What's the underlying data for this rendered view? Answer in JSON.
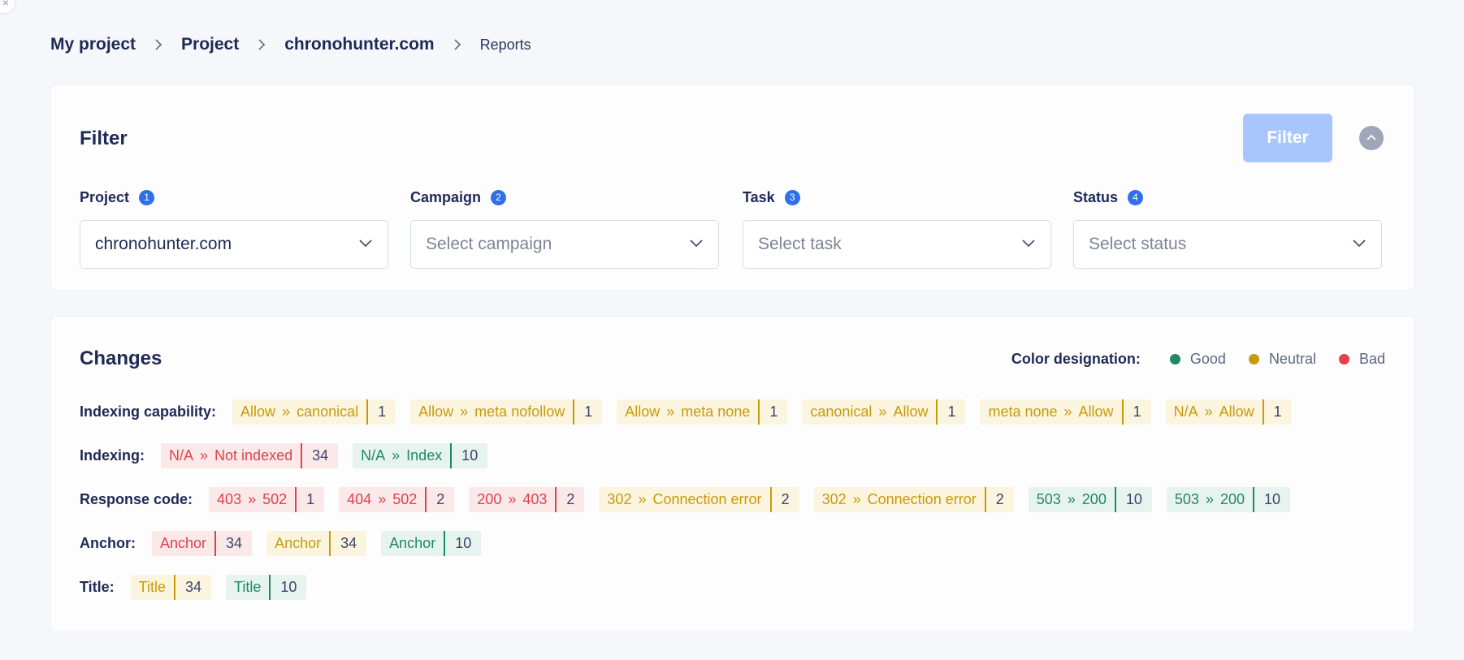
{
  "breadcrumb": {
    "items": [
      "My project",
      "Project",
      "chronohunter.com"
    ],
    "current": "Reports"
  },
  "filter": {
    "title": "Filter",
    "button_label": "Filter",
    "fields": [
      {
        "label": "Project",
        "badge": "1",
        "value": "chronohunter.com",
        "placeholder": false
      },
      {
        "label": "Campaign",
        "badge": "2",
        "value": "Select campaign",
        "placeholder": true
      },
      {
        "label": "Task",
        "badge": "3",
        "value": "Select task",
        "placeholder": true
      },
      {
        "label": "Status",
        "badge": "4",
        "value": "Select status",
        "placeholder": true
      }
    ]
  },
  "changes": {
    "title": "Changes",
    "legend": {
      "title": "Color designation:",
      "items": [
        {
          "label": "Good",
          "color": "#1f8a5e"
        },
        {
          "label": "Neutral",
          "color": "#c99a08"
        },
        {
          "label": "Bad",
          "color": "#e0414a"
        }
      ]
    },
    "rows": [
      {
        "label": "Indexing capability:",
        "tags": [
          {
            "from": "Allow",
            "to": "canonical",
            "count": "1",
            "status": "neutral"
          },
          {
            "from": "Allow",
            "to": "meta nofollow",
            "count": "1",
            "status": "neutral"
          },
          {
            "from": "Allow",
            "to": "meta none",
            "count": "1",
            "status": "neutral"
          },
          {
            "from": "canonical",
            "to": "Allow",
            "count": "1",
            "status": "neutral"
          },
          {
            "from": "meta none",
            "to": "Allow",
            "count": "1",
            "status": "neutral"
          },
          {
            "from": "N/A",
            "to": "Allow",
            "count": "1",
            "status": "neutral"
          }
        ]
      },
      {
        "label": "Indexing:",
        "tags": [
          {
            "from": "N/A",
            "to": "Not indexed",
            "count": "34",
            "status": "bad"
          },
          {
            "from": "N/A",
            "to": "Index",
            "count": "10",
            "status": "good"
          }
        ]
      },
      {
        "label": "Response code:",
        "tags": [
          {
            "from": "403",
            "to": "502",
            "count": "1",
            "status": "bad"
          },
          {
            "from": "404",
            "to": "502",
            "count": "2",
            "status": "bad"
          },
          {
            "from": "200",
            "to": "403",
            "count": "2",
            "status": "bad"
          },
          {
            "from": "302",
            "to": "Connection error",
            "count": "2",
            "status": "neutral"
          },
          {
            "from": "302",
            "to": "Connection error",
            "count": "2",
            "status": "neutral"
          },
          {
            "from": "503",
            "to": "200",
            "count": "10",
            "status": "good"
          },
          {
            "from": "503",
            "to": "200",
            "count": "10",
            "status": "good"
          }
        ]
      },
      {
        "label": "Anchor:",
        "tags": [
          {
            "from": "Anchor",
            "to": "",
            "count": "34",
            "status": "bad"
          },
          {
            "from": "Anchor",
            "to": "",
            "count": "34",
            "status": "neutral"
          },
          {
            "from": "Anchor",
            "to": "",
            "count": "10",
            "status": "good"
          }
        ]
      },
      {
        "label": "Title:",
        "tags": [
          {
            "from": "Title",
            "to": "",
            "count": "34",
            "status": "neutral"
          },
          {
            "from": "Title",
            "to": "",
            "count": "10",
            "status": "good"
          }
        ]
      }
    ]
  }
}
